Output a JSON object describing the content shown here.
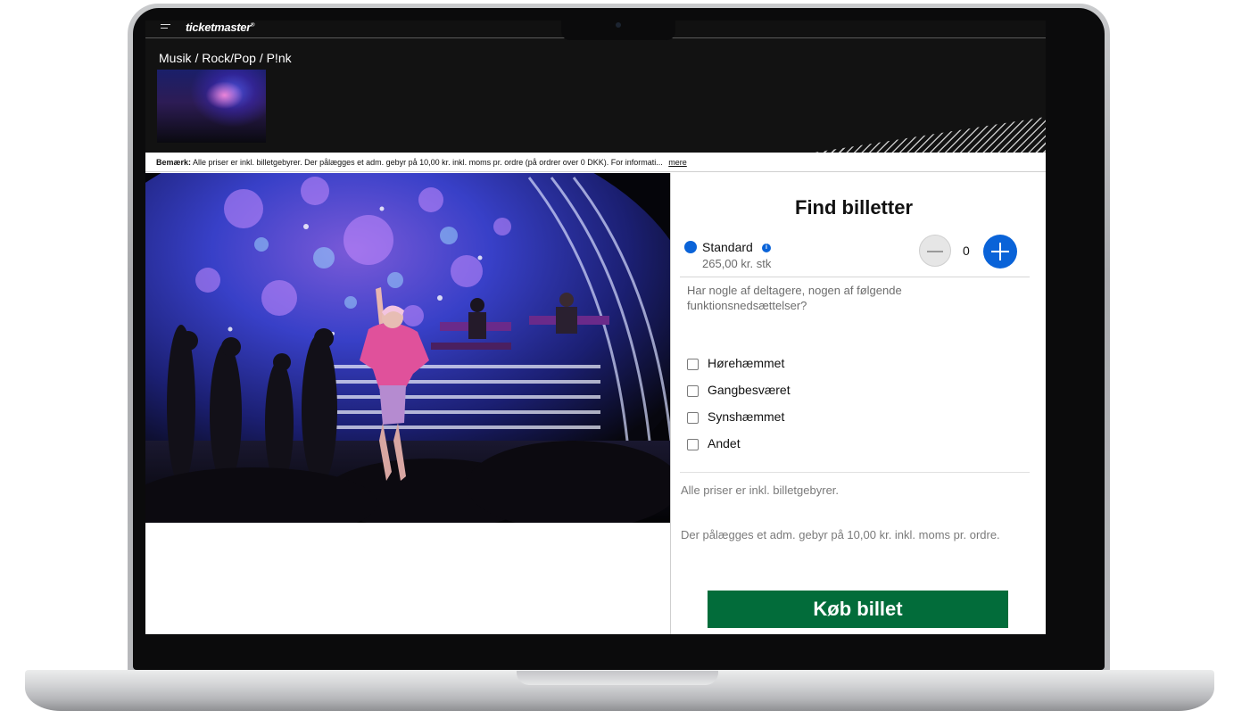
{
  "header": {
    "logo": "ticketmaster",
    "logo_mark": "®",
    "breadcrumb": "Musik / Rock/Pop / P!nk"
  },
  "notice": {
    "label": "Bemærk:",
    "text": "Alle priser er inkl. billetgebyrer. Der pålægges et adm. gebyr på 10,00 kr. inkl. moms pr. ordre (på ordrer over 0 DKK). For informati...",
    "more_link": "mere"
  },
  "tickets": {
    "title": "Find billetter",
    "type_name": "Standard",
    "info_icon": "i",
    "price": "265,00 kr. stk",
    "quantity": "0",
    "accessibility_question": "Har nogle af deltagere, nogen af følgende funktionsnedsættelser?",
    "options": [
      "Hørehæmmet",
      "Gangbesværet",
      "Synshæmmet",
      "Andet"
    ],
    "fee_note_1": "Alle priser er inkl. billetgebyrer.",
    "fee_note_2": "Der pålægges et adm. gebyr på 10,00 kr. inkl. moms pr. ordre.",
    "buy_label": "Køb billet"
  },
  "colors": {
    "accent_blue": "#0a63d8",
    "buy_green": "#026c3a",
    "header_dark": "#121212"
  }
}
